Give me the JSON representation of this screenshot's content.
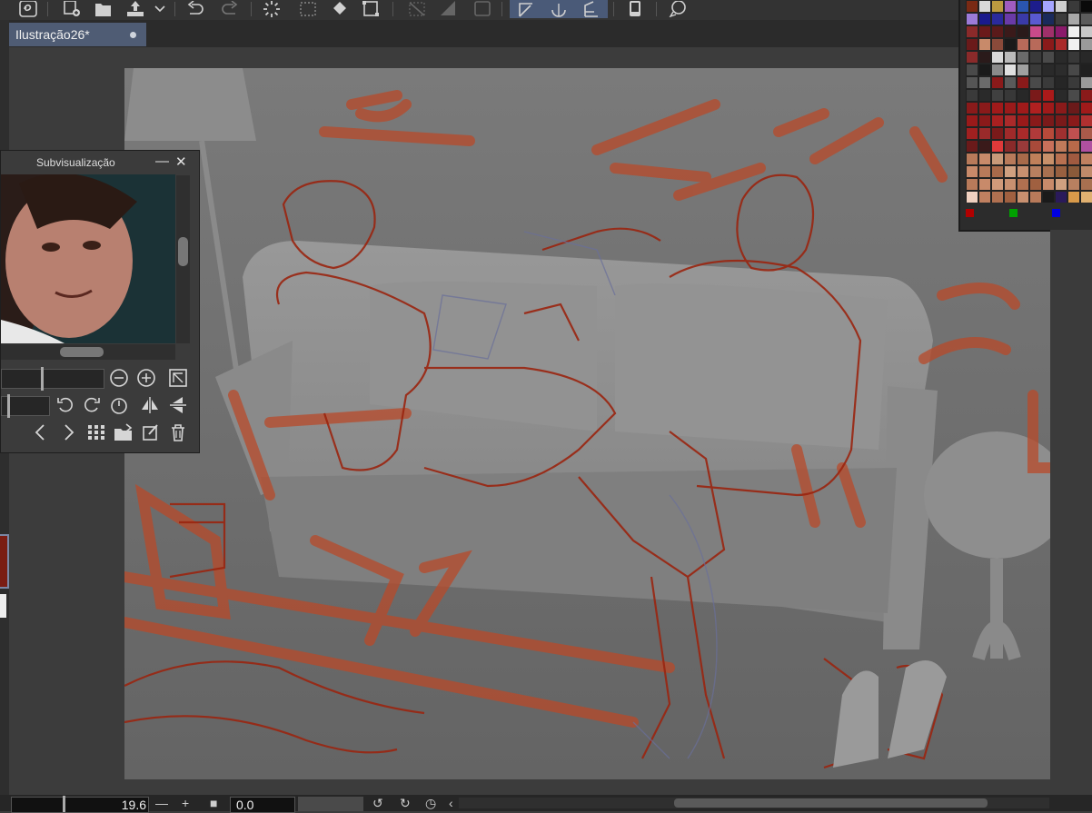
{
  "document": {
    "tab_title": "Ilustração26*"
  },
  "toolbar": {
    "icons": [
      "logo-icon",
      "new-layer-icon",
      "open-folder-icon",
      "export-icon",
      "chevron-down-icon",
      "undo-icon",
      "redo-icon",
      "loading-icon",
      "select-icon",
      "fill-icon",
      "transform-icon",
      "snap-icon",
      "ruler-icon",
      "frame-icon",
      "perspective-icon",
      "symmetry-icon",
      "grid-icon",
      "tablet-icon",
      "help-icon"
    ]
  },
  "subview": {
    "title": "Subvisualização",
    "minimize_symbol": "—",
    "close_symbol": "✕"
  },
  "status": {
    "zoom_value": "19.6",
    "rotation_value": "0.0"
  },
  "palette": {
    "colors": [
      "#7a2a14",
      "#d8d8d8",
      "#bb9a40",
      "#a05cc0",
      "#2a55b0",
      "#1d1d8c",
      "#a5a5ff",
      "#d0d0d0",
      "#3a3a3a",
      "#0a0a0a",
      "#9c7bd8",
      "#1a1a8c",
      "#2a2a9c",
      "#6a3aa8",
      "#3a3aa8",
      "#5a5ad0",
      "#1a2a5c",
      "#3c3c3c",
      "#a8a8a8",
      "#5c5c5c",
      "#8a2a2a",
      "#6a1a1a",
      "#5a1a1a",
      "#3a1a1a",
      "#2a1a1a",
      "#c84a8a",
      "#a0306a",
      "#8a1a6a",
      "#f0f0f0",
      "#c8c8c8",
      "#6a1a1a",
      "#c88a6a",
      "#8a4a3a",
      "#1a1a1a",
      "#b86a5a",
      "#b86a5a",
      "#8a1a1a",
      "#aa2a2a",
      "#f0f0f0",
      "#9a9a9a",
      "#8a2a2a",
      "#2a1a1a",
      "#d8d8d8",
      "#bababa",
      "#6a6a6a",
      "#3a3a3a",
      "#4a4a4a",
      "#2a2a2a",
      "#383838",
      "#282828",
      "#4a4a4a",
      "#1a1a1a",
      "#8a8a8a",
      "#e0e0e0",
      "#a0a0a0",
      "#3a3a3a",
      "#2a2a2a",
      "#2c2c2c",
      "#484848",
      "#202020",
      "#555555",
      "#6a6a6a",
      "#8a1a1a",
      "#5a5a5a",
      "#8a1a1a",
      "#4a4a4a",
      "#3a3a3a",
      "#262626",
      "#3a3a3a",
      "#9a9a9a",
      "#3a3a3a",
      "#2a2a2a",
      "#404040",
      "#383838",
      "#282828",
      "#7a1a1a",
      "#aa1a1a",
      "#2a2a2a",
      "#4a4a4a",
      "#8a1a1a",
      "#8a1a1a",
      "#8a1a1a",
      "#a01a1a",
      "#9a1a1a",
      "#a01a1a",
      "#b02020",
      "#a01a1a",
      "#8a1a1a",
      "#6a1a1a",
      "#a01a1a",
      "#9a1a1a",
      "#8a1a1a",
      "#a82020",
      "#aa2a2a",
      "#9a1a1a",
      "#8a1a1a",
      "#7a1a1a",
      "#7a1a1a",
      "#8a1a1a",
      "#b03030",
      "#a02020",
      "#9a2a2a",
      "#7a1a1a",
      "#a02a2a",
      "#aa2a2a",
      "#b03a3a",
      "#b84a3a",
      "#a03030",
      "#c05050",
      "#aa5a4a",
      "#6a1a1a",
      "#3a1a1a",
      "#e03a3a",
      "#8a2a2a",
      "#9a3a3a",
      "#a84a3a",
      "#c8705a",
      "#c07a5a",
      "#b86a4a",
      "#b050a0",
      "#b87a5a",
      "#c88a6a",
      "#c89a7a",
      "#b87a5a",
      "#a86a4a",
      "#c0805a",
      "#c8906a",
      "#b87050",
      "#a05a40",
      "#c08060",
      "#c88a6a",
      "#b87a5a",
      "#a86a4a",
      "#d0a080",
      "#c89070",
      "#b88060",
      "#a87050",
      "#986040",
      "#8a5a3a",
      "#c08a6a",
      "#b87a5a",
      "#c88a6a",
      "#d09a7a",
      "#c89070",
      "#b07050",
      "#a06040",
      "#c88a6a",
      "#d0a080",
      "#b88060",
      "#a87050",
      "#f0d0c0",
      "#c08060",
      "#b07050",
      "#a06040",
      "#c89070",
      "#b87a5a",
      "#1a1a1a",
      "#2a1a5a",
      "#d89a4a",
      "#e0b070"
    ],
    "current_colors": [
      "#b00000",
      "#00a000",
      "#0000e0"
    ]
  }
}
